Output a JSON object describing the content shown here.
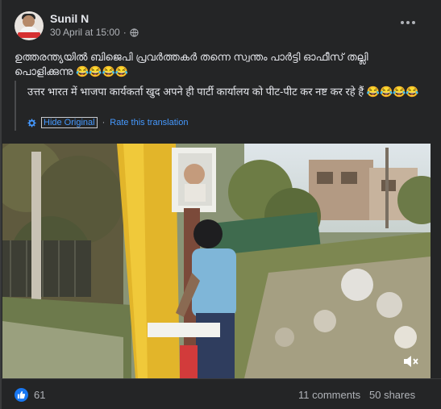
{
  "post": {
    "author": "Sunil N",
    "timestamp": "30 April at 15:00",
    "separator": "·",
    "privacy_icon": "globe-icon",
    "text": "ഉത്തരന്ത്യയിൽ ബിജെപി പ്രവർത്തകർ തന്നെ സ്വന്തം പാർട്ടി ഓഫീസ് തല്ലി പൊളിക്കുന്നു 😂😂😂😂"
  },
  "translation": {
    "text": "उत्तर भारत में भाजपा कार्यकर्ता खुद अपने ही पार्टी कार्यालय को पीट-पीट कर नष्ट कर रहे हैं 😂😂😂😂",
    "hide_label": "Hide Original",
    "separator": "·",
    "rate_label": "Rate this translation"
  },
  "video": {
    "muted_icon": "speaker-muted-icon"
  },
  "footer": {
    "like_count": "61",
    "comments": "11 comments",
    "shares": "50 shares"
  },
  "colors": {
    "background": "#242526",
    "text": "#e4e6eb",
    "secondary_text": "#b0b3b8",
    "link": "#4599ff",
    "like_blue": "#1877f2"
  }
}
